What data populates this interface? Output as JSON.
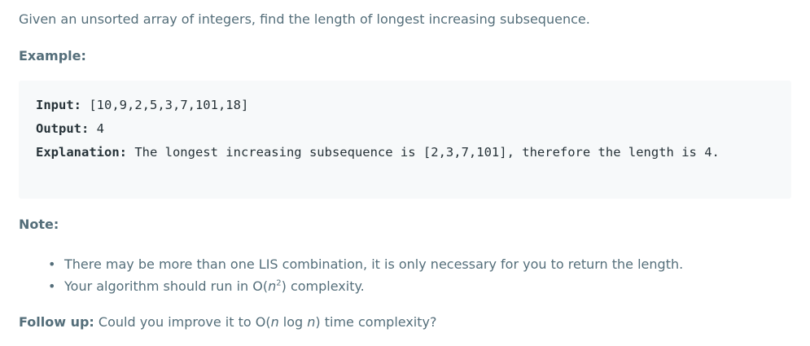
{
  "intro": "Given an unsorted array of integers, find the length of longest increasing subsequence.",
  "example": {
    "heading": "Example:",
    "input_label": "Input:",
    "input_value": " [10,9,2,5,3,7,101,18]",
    "output_label": "Output:",
    "output_value": " 4",
    "explanation_label": "Explanation:",
    "explanation_value": " The longest increasing subsequence is [2,3,7,101], therefore the length is 4."
  },
  "note": {
    "heading": "Note:",
    "bullets": [
      {
        "text": "There may be more than one LIS combination, it is only necessary for you to return the length."
      },
      {
        "text_before": "Your algorithm should run in O(",
        "var": "n",
        "sup": "2",
        "text_after": ") complexity."
      }
    ]
  },
  "follow_up": {
    "label": "Follow up:",
    "text_before": " Could you improve it to O(",
    "var1": "n",
    "mid": " log ",
    "var2": "n",
    "text_after": ") time complexity?"
  }
}
